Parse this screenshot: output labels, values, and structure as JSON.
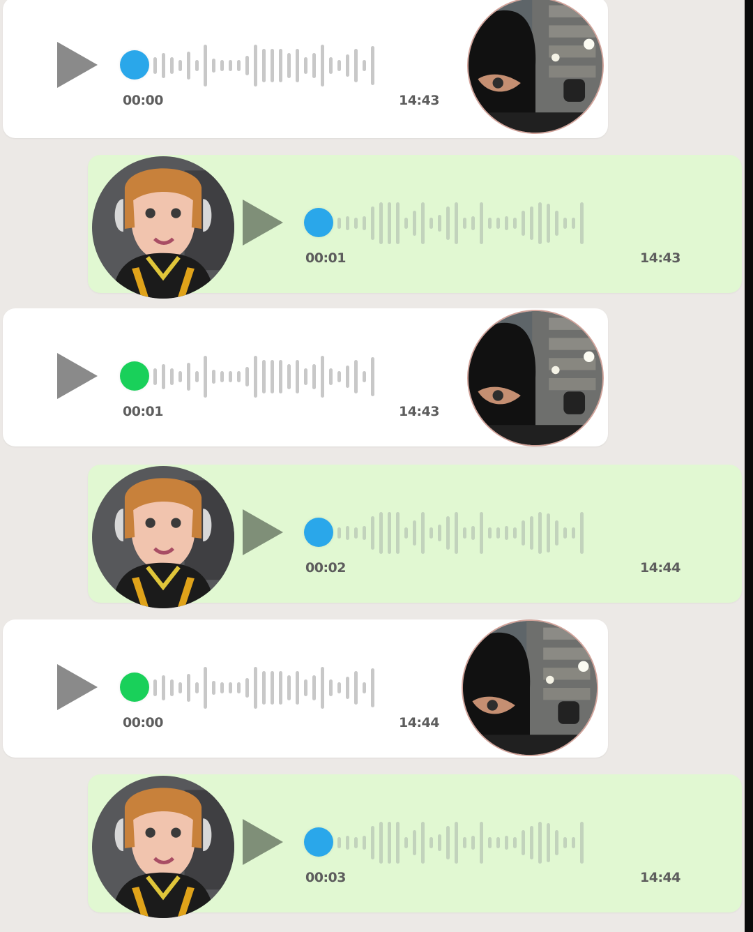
{
  "colors": {
    "background": "#ece9e6",
    "incoming_bubble": "#ffffff",
    "outgoing_bubble": "#e1f8d2",
    "dot_blue": "#2aa7ea",
    "dot_green": "#19d05a"
  },
  "messages": [
    {
      "sender": "masked",
      "progress_dot_color": "#2aa7ea",
      "elapsed": "00:00",
      "sent_time": "14:43",
      "icon": "play-icon"
    },
    {
      "sender": "girl",
      "progress_dot_color": "#2aa7ea",
      "elapsed": "00:01",
      "sent_time": "14:43",
      "icon": "play-icon"
    },
    {
      "sender": "masked",
      "progress_dot_color": "#19d05a",
      "elapsed": "00:01",
      "sent_time": "14:43",
      "icon": "play-icon"
    },
    {
      "sender": "girl",
      "progress_dot_color": "#2aa7ea",
      "elapsed": "00:02",
      "sent_time": "14:44",
      "icon": "play-icon"
    },
    {
      "sender": "masked",
      "progress_dot_color": "#19d05a",
      "elapsed": "00:00",
      "sent_time": "14:44",
      "icon": "play-icon"
    },
    {
      "sender": "girl",
      "progress_dot_color": "#2aa7ea",
      "elapsed": "00:03",
      "sent_time": "14:44",
      "icon": "play-icon"
    }
  ]
}
